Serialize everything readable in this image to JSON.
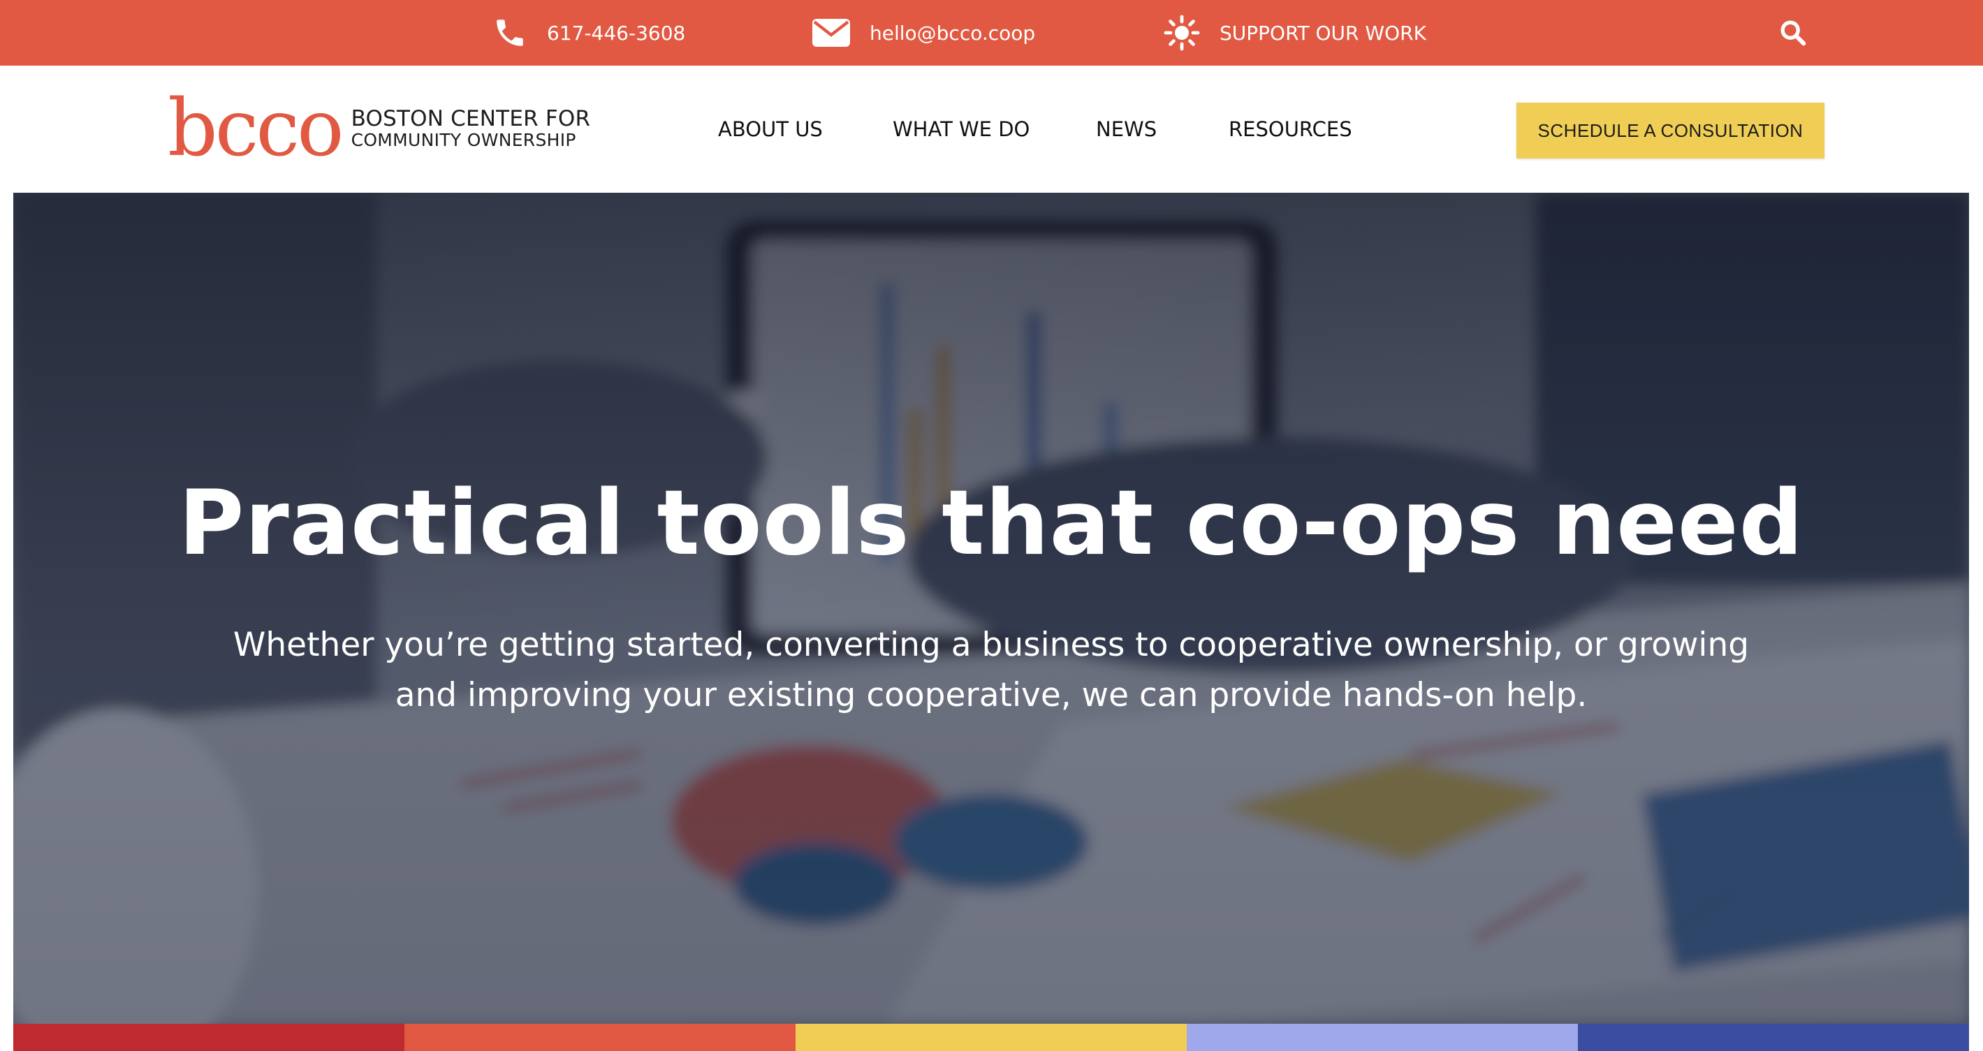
{
  "topbar": {
    "phone": {
      "icon": "phone-icon",
      "text": "617-446-3608"
    },
    "email": {
      "icon": "envelope-icon",
      "text": "hello@bcco.coop"
    },
    "support": {
      "icon": "sun-icon",
      "text": "SUPPORT OUR WORK"
    },
    "search": {
      "icon": "search-icon"
    },
    "bg_color": "#e15942"
  },
  "header": {
    "logo": {
      "wordmark": "bcco",
      "line1": "BOSTON CENTER FOR",
      "line2": "COMMUNITY OWNERSHIP",
      "color": "#e15942"
    },
    "nav": [
      "ABOUT US",
      "WHAT WE DO",
      "NEWS",
      "RESOURCES"
    ],
    "cta": {
      "label": "SCHEDULE A CONSULTATION",
      "color": "#f0ce56"
    }
  },
  "hero": {
    "title": "Practical tools that co-ops need",
    "subtitle": "Whether you’re getting started, converting a business to cooperative ownership, or growing and improving your existing cooperative, we can provide hands-on help."
  },
  "color_strip": [
    "#be2a2f",
    "#e15942",
    "#f0ce56",
    "#9fa8ea",
    "#3b4da0"
  ]
}
